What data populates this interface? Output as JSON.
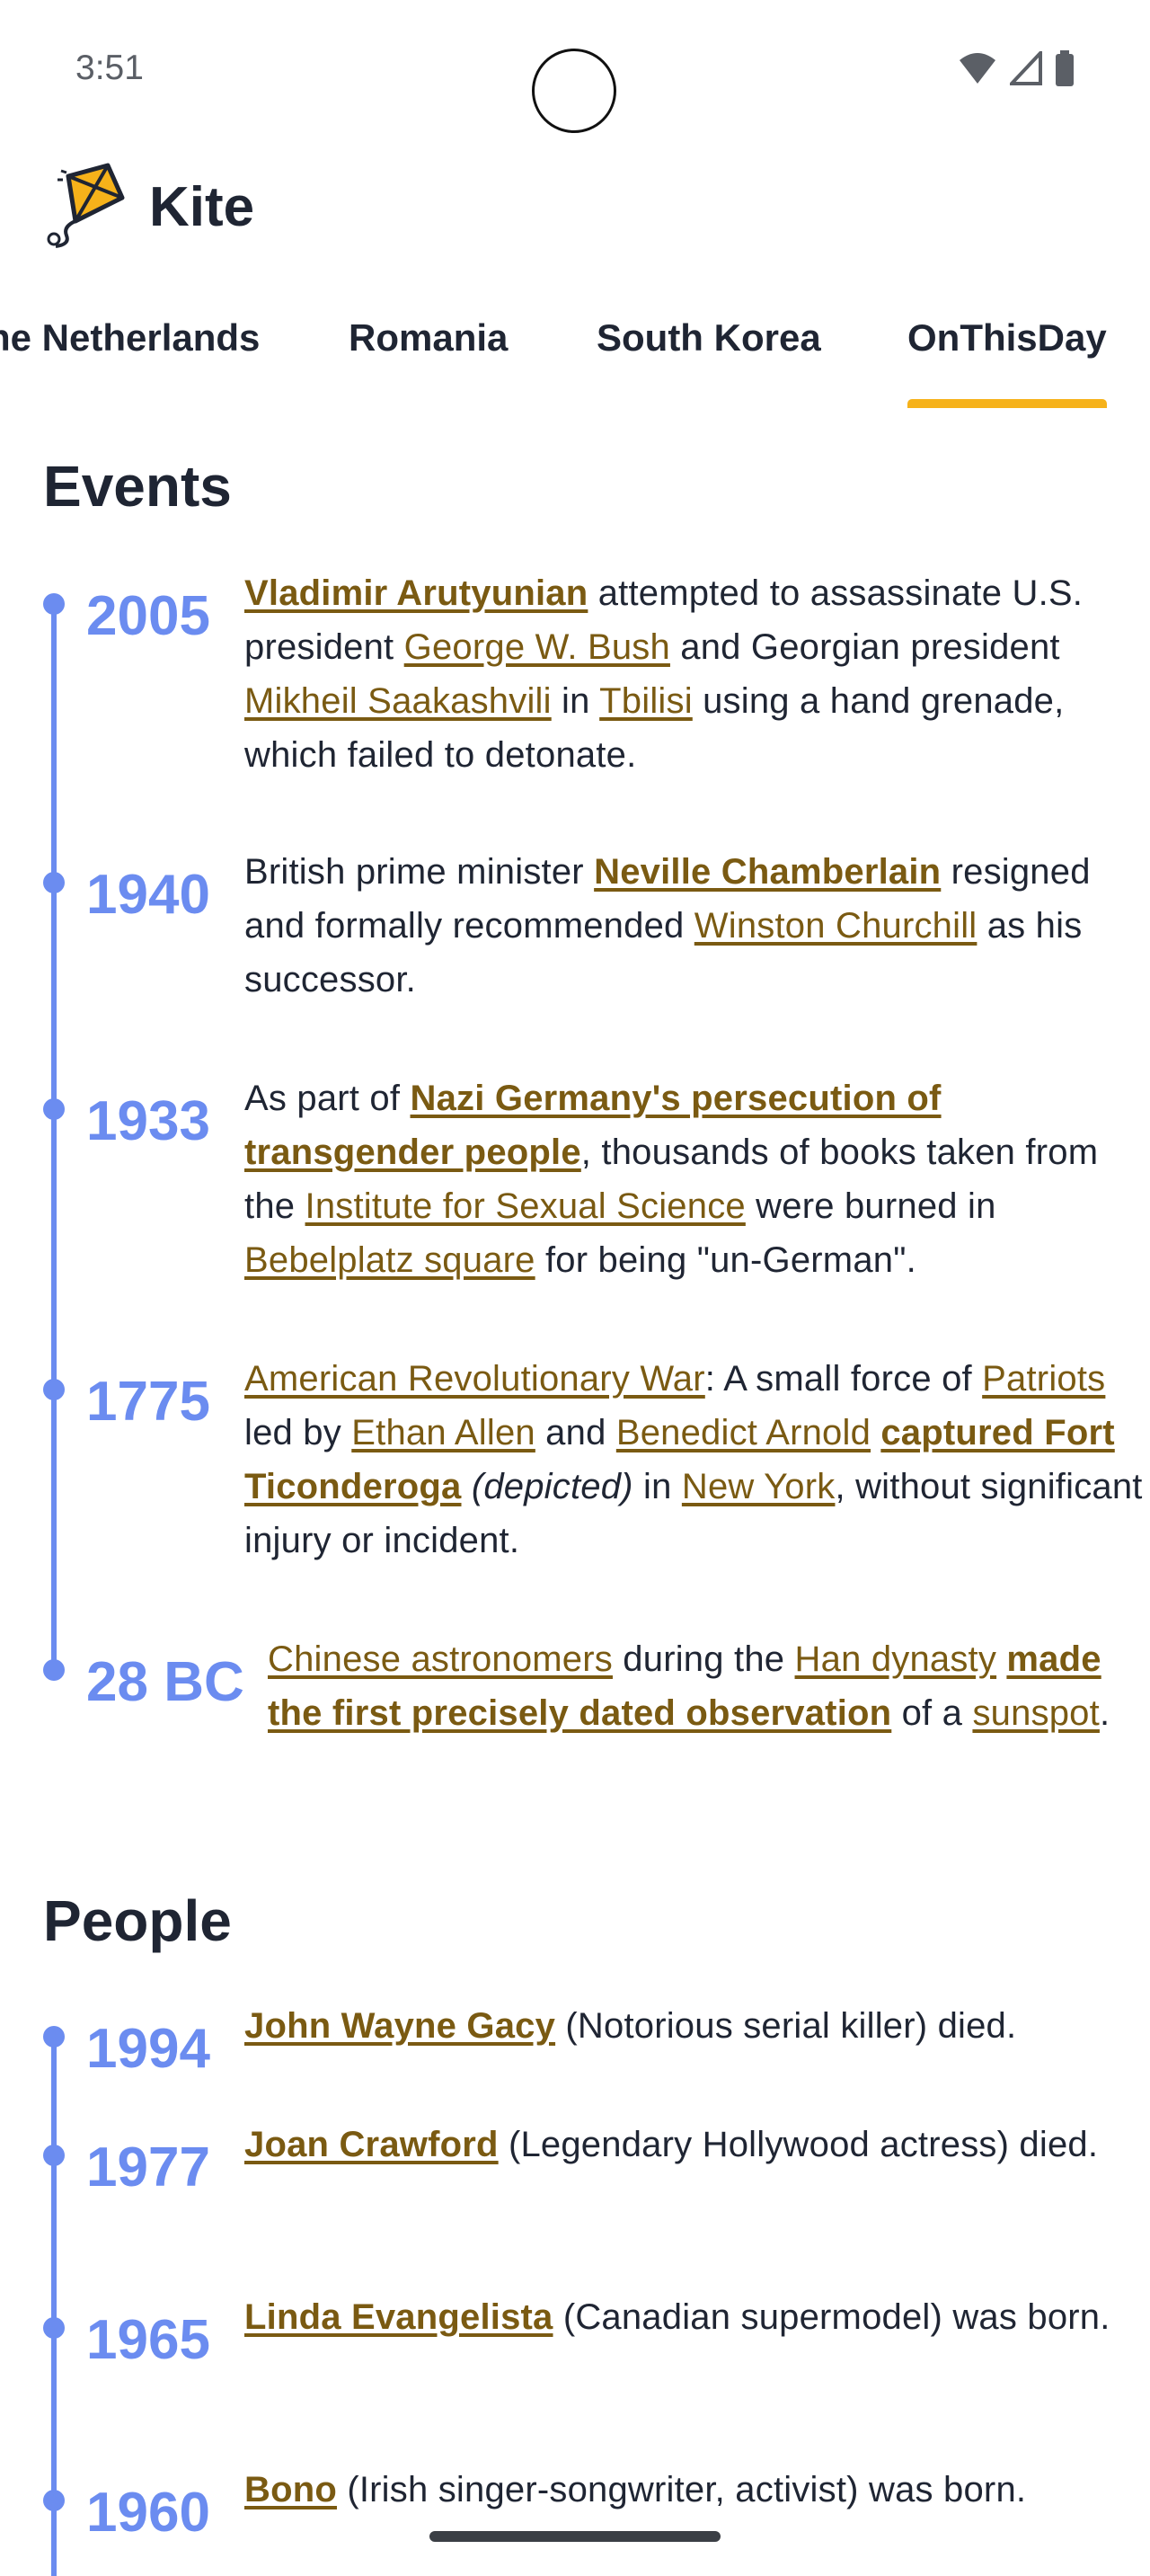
{
  "status": {
    "time": "3:51"
  },
  "app": {
    "title": "Kite"
  },
  "tabs": [
    "he Netherlands",
    "Romania",
    "South Korea",
    "OnThisDay"
  ],
  "colors": {
    "accent": "#f6b21a",
    "timeline": "#6b8cf0",
    "link": "#7a5a12"
  },
  "events": {
    "title": "Events",
    "items": [
      {
        "year": "2005",
        "parts": [
          {
            "t": "Vladimir Arutyunian",
            "link": true,
            "strong": true
          },
          {
            "t": " attempted to assassinate U.S. president "
          },
          {
            "t": "George W. Bush",
            "link": true
          },
          {
            "t": " and Georgian president "
          },
          {
            "t": "Mikheil Saakashvili",
            "link": true
          },
          {
            "t": " in "
          },
          {
            "t": "Tbilisi",
            "link": true
          },
          {
            "t": " using a hand grenade, which failed to detonate."
          }
        ]
      },
      {
        "year": "1940",
        "parts": [
          {
            "t": "British prime minister "
          },
          {
            "t": "Neville Chamberlain",
            "link": true,
            "strong": true
          },
          {
            "t": " resigned and formally recommended "
          },
          {
            "t": "Winston Churchill",
            "link": true
          },
          {
            "t": " as his successor."
          }
        ]
      },
      {
        "year": "1933",
        "parts": [
          {
            "t": "As part of "
          },
          {
            "t": "Nazi Germany's persecution of transgender people",
            "link": true,
            "strong": true
          },
          {
            "t": ", thousands of books taken from the "
          },
          {
            "t": "Institute for Sexual Science",
            "link": true
          },
          {
            "t": " were burned in "
          },
          {
            "t": "Bebelplatz square",
            "link": true
          },
          {
            "t": " for being \"un-German\"."
          }
        ]
      },
      {
        "year": "1775",
        "parts": [
          {
            "t": "American Revolutionary War",
            "link": true
          },
          {
            "t": ": A small force of "
          },
          {
            "t": "Patriots",
            "link": true
          },
          {
            "t": " led by "
          },
          {
            "t": "Ethan Allen",
            "link": true
          },
          {
            "t": " and "
          },
          {
            "t": "Benedict Arnold",
            "link": true
          },
          {
            "t": " "
          },
          {
            "t": "captured Fort Ticonderoga",
            "link": true,
            "strong": true
          },
          {
            "t": " "
          },
          {
            "t": "(depicted)",
            "em": true
          },
          {
            "t": " in "
          },
          {
            "t": "New York",
            "link": true
          },
          {
            "t": ", without significant injury or incident."
          }
        ]
      },
      {
        "year": "28 BC",
        "parts": [
          {
            "t": "Chinese astronomers",
            "link": true
          },
          {
            "t": " during the "
          },
          {
            "t": "Han dynasty",
            "link": true
          },
          {
            "t": " "
          },
          {
            "t": "made the first precisely dated observation",
            "link": true,
            "strong": true
          },
          {
            "t": " of a "
          },
          {
            "t": "sunspot",
            "link": true
          },
          {
            "t": "."
          }
        ]
      }
    ]
  },
  "people": {
    "title": "People",
    "items": [
      {
        "year": "1994",
        "parts": [
          {
            "t": "John Wayne Gacy",
            "link": true,
            "strong": true
          },
          {
            "t": " (Notorious serial killer) died."
          }
        ]
      },
      {
        "year": "1977",
        "parts": [
          {
            "t": "Joan Crawford",
            "link": true,
            "strong": true
          },
          {
            "t": " (Legendary Hollywood actress) died."
          }
        ]
      },
      {
        "year": "1965",
        "parts": [
          {
            "t": "Linda Evangelista",
            "link": true,
            "strong": true
          },
          {
            "t": " (Canadian supermodel) was born."
          }
        ]
      },
      {
        "year": "1960",
        "parts": [
          {
            "t": "Bono",
            "link": true,
            "strong": true
          },
          {
            "t": " (Irish singer-songwriter, activist) was born."
          }
        ]
      }
    ]
  }
}
